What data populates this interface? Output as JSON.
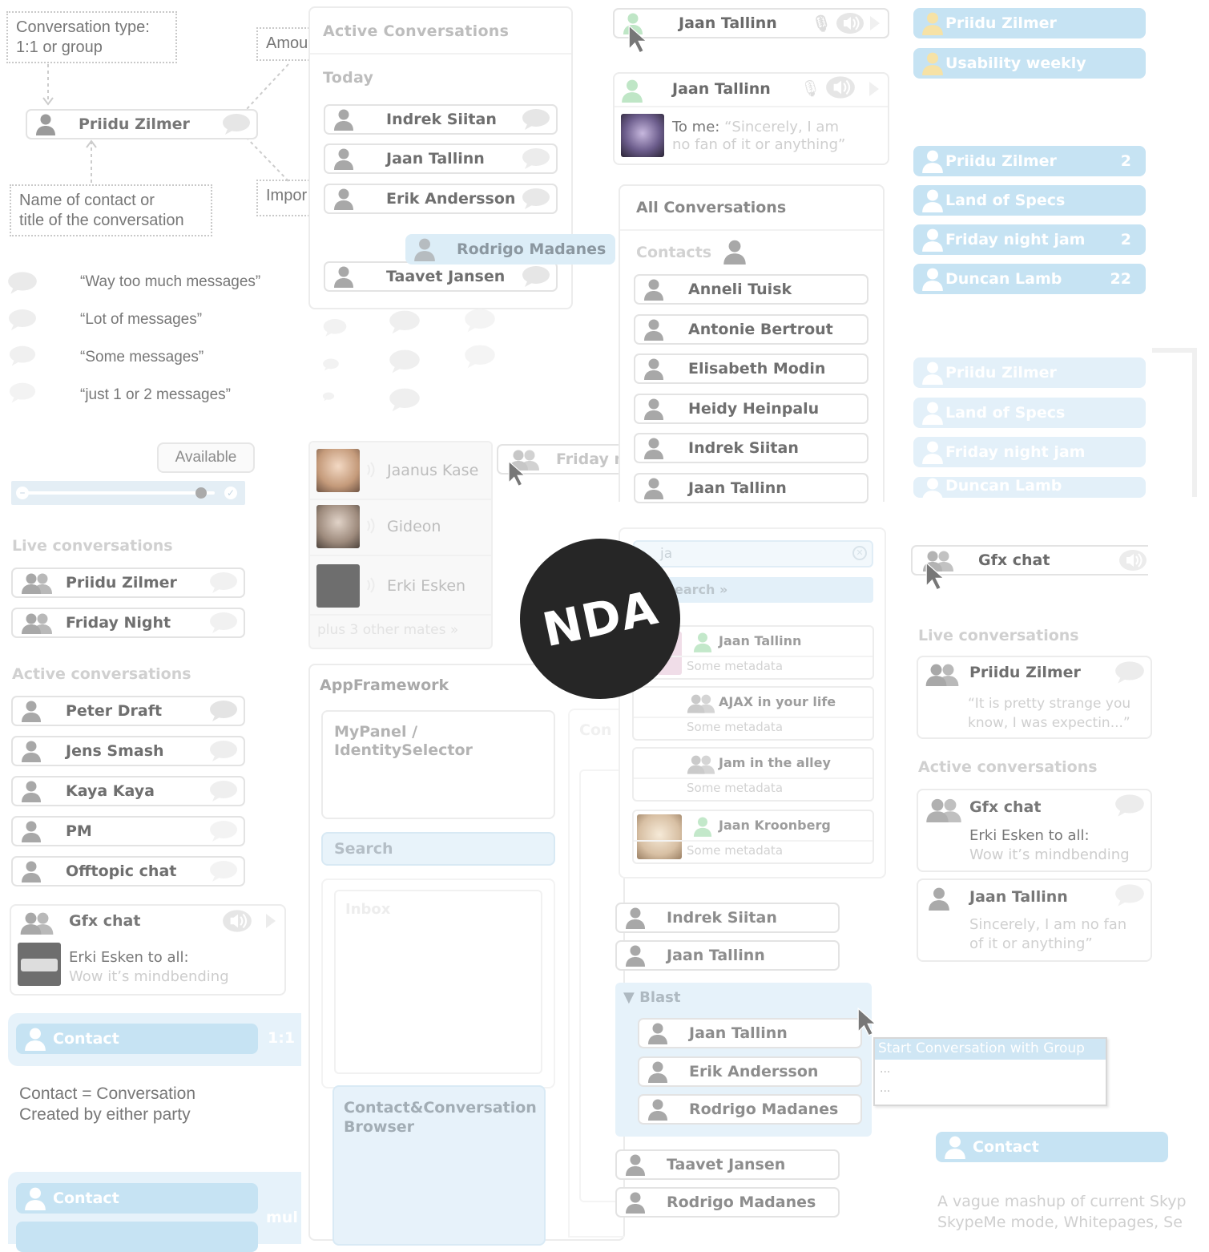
{
  "notes": {
    "conv_type": "Conversation type:\n1:1 or group",
    "amount": "Amou",
    "importance": "Impor",
    "name_of_contact": "Name of contact or\ntitle of the conversation",
    "example_name": "Priidu Zilmer"
  },
  "legend": [
    "“Way too much messages”",
    "“Lot of messages”",
    "“Some messages”",
    "“just 1 or 2 messages”"
  ],
  "status": {
    "label": "Available",
    "level": 0.93
  },
  "left": {
    "live_title": "Live conversations",
    "live": [
      "Priidu Zilmer",
      "Friday Night"
    ],
    "active_title": "Active conversations",
    "active": [
      "Peter Draft",
      "Jens Smash",
      "Kaya Kaya",
      "PM",
      "Offtopic chat"
    ],
    "gfx_title": "Gfx chat",
    "gfx_sender": "Erki Esken to all:",
    "gfx_msg": "Wow it’s mindbending",
    "contact_label": "Contact",
    "contact_type": "1:1",
    "contact_desc": "Contact = Conversation\nCreated by either party",
    "contact2_label": "Contact",
    "contact2_type": "mul"
  },
  "active_panel": {
    "title": "Active Conversations",
    "today": "Today",
    "items": [
      "Indrek Siitan",
      "Jaan Tallinn",
      "Erik Andersson",
      "Taavet Jansen"
    ],
    "dragging": "Rodrigo Madanes"
  },
  "mates": {
    "items": [
      "Jaanus Kase",
      "Gideon",
      "Erki Esken"
    ],
    "more": "plus 3 other mates »",
    "friday": "Friday n"
  },
  "app": {
    "title": "AppFramework",
    "mypanel": "MyPanel /\nIdentitySelector",
    "search": "Search",
    "inbox": "Inbox",
    "browser": "Contact&Conversation\nBrowser",
    "conv_cut": "Con"
  },
  "top_mid": {
    "name1": "Jaan Tallinn",
    "name2": "Jaan Tallinn",
    "tome": "To me: ",
    "quote": "“Sincerely, I am\nno fan of it or anything”"
  },
  "all_conv": {
    "title": "All Conversations",
    "contacts": "Contacts",
    "items": [
      "Anneli Tuisk",
      "Antonie Bertrout",
      "Elisabeth Modin",
      "Heidy Heinpalu",
      "Indrek Siitan",
      "Jaan Tallinn"
    ]
  },
  "search_panel": {
    "query": "ja",
    "search_link": "earch »",
    "results": [
      {
        "name": "Jaan Tallinn",
        "meta": "Some metadata"
      },
      {
        "name": "AJAX in your life",
        "meta": "Some metadata"
      },
      {
        "name": "Jam in the alley",
        "meta": "Some metadata"
      },
      {
        "name": "Jaan Kroonberg",
        "meta": "Some metadata"
      }
    ]
  },
  "group_list": {
    "top": [
      "Indrek Siitan",
      "Jaan Tallinn"
    ],
    "group_name": "Blast",
    "group_items": [
      "Jaan Tallinn",
      "Erik Andersson",
      "Rodrigo Madanes"
    ],
    "bottom": [
      "Taavet Jansen",
      "Rodrigo Madanes"
    ],
    "menu_title": "Start Conversation with Group",
    "menu_items": [
      "...",
      "..."
    ]
  },
  "right": {
    "pills1": [
      {
        "name": "Priidu Zilmer",
        "count": ""
      },
      {
        "name": "Usability weekly",
        "count": ""
      }
    ],
    "pills2": [
      {
        "name": "Priidu Zilmer",
        "count": "2"
      },
      {
        "name": "Land of Specs",
        "count": ""
      },
      {
        "name": "Friday night jam",
        "count": "2"
      },
      {
        "name": "Duncan Lamb",
        "count": "22"
      }
    ],
    "pills3": [
      "Priidu Zilmer",
      "Land of Specs",
      "Friday night jam",
      "Duncan Lamb"
    ],
    "gfx": "Gfx chat",
    "live_title": "Live conversations",
    "live_name": "Priidu Zilmer",
    "live_msg": "“It is pretty strange you\nknow, I was expectin...”",
    "active_title": "Active conversations",
    "a1_name": "Gfx chat",
    "a1_sender": "Erki Esken to all:",
    "a1_msg": "Wow it’s mindbending",
    "a2_name": "Jaan Tallinn",
    "a2_msg": "Sincerely, I am no fan\nof it or anything”",
    "contact": "Contact",
    "footer": "A vague mashup of current Skyp\nSkypeMe mode, Whitepages, Se"
  },
  "badge": "NDA"
}
